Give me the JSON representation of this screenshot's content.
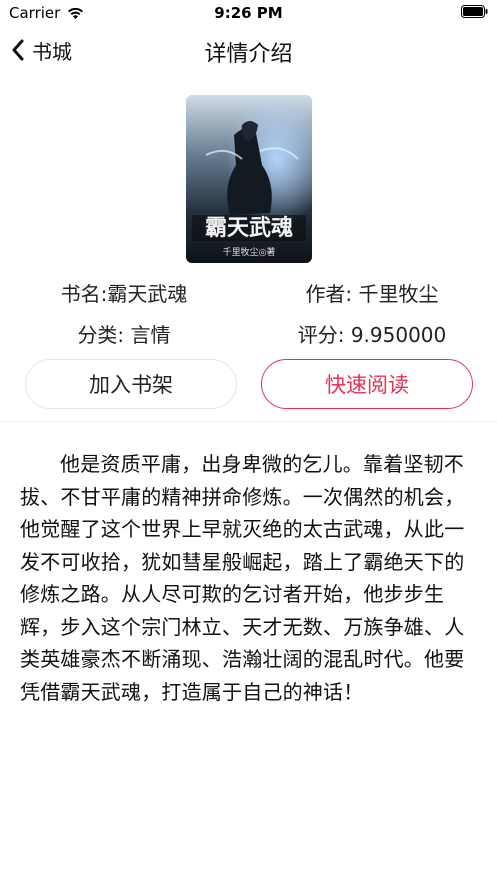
{
  "status_bar": {
    "carrier": "Carrier",
    "time": "9:26 PM"
  },
  "nav": {
    "back_label": "书城",
    "title": "详情介绍"
  },
  "book": {
    "name_label": "书名:霸天武魂",
    "author_label": "作者: 千里牧尘",
    "category_label": "分类: 言情",
    "score_label": "评分: 9.950000",
    "cover_title": "霸天武魂",
    "cover_author": "千里牧尘◎著"
  },
  "actions": {
    "add_shelf": "加入书架",
    "read_now": "快速阅读"
  },
  "colors": {
    "accent": "#e8325a"
  },
  "description": "他是资质平庸，出身卑微的乞儿。靠着坚韧不拔、不甘平庸的精神拼命修炼。一次偶然的机会，他觉醒了这个世界上早就灭绝的太古武魂，从此一发不可收拾，犹如彗星般崛起，踏上了霸绝天下的修炼之路。从人尽可欺的乞讨者开始，他步步生辉，步入这个宗门林立、天才无数、万族争雄、人类英雄豪杰不断涌现、浩瀚壮阔的混乱时代。他要凭借霸天武魂，打造属于自己的神话！"
}
